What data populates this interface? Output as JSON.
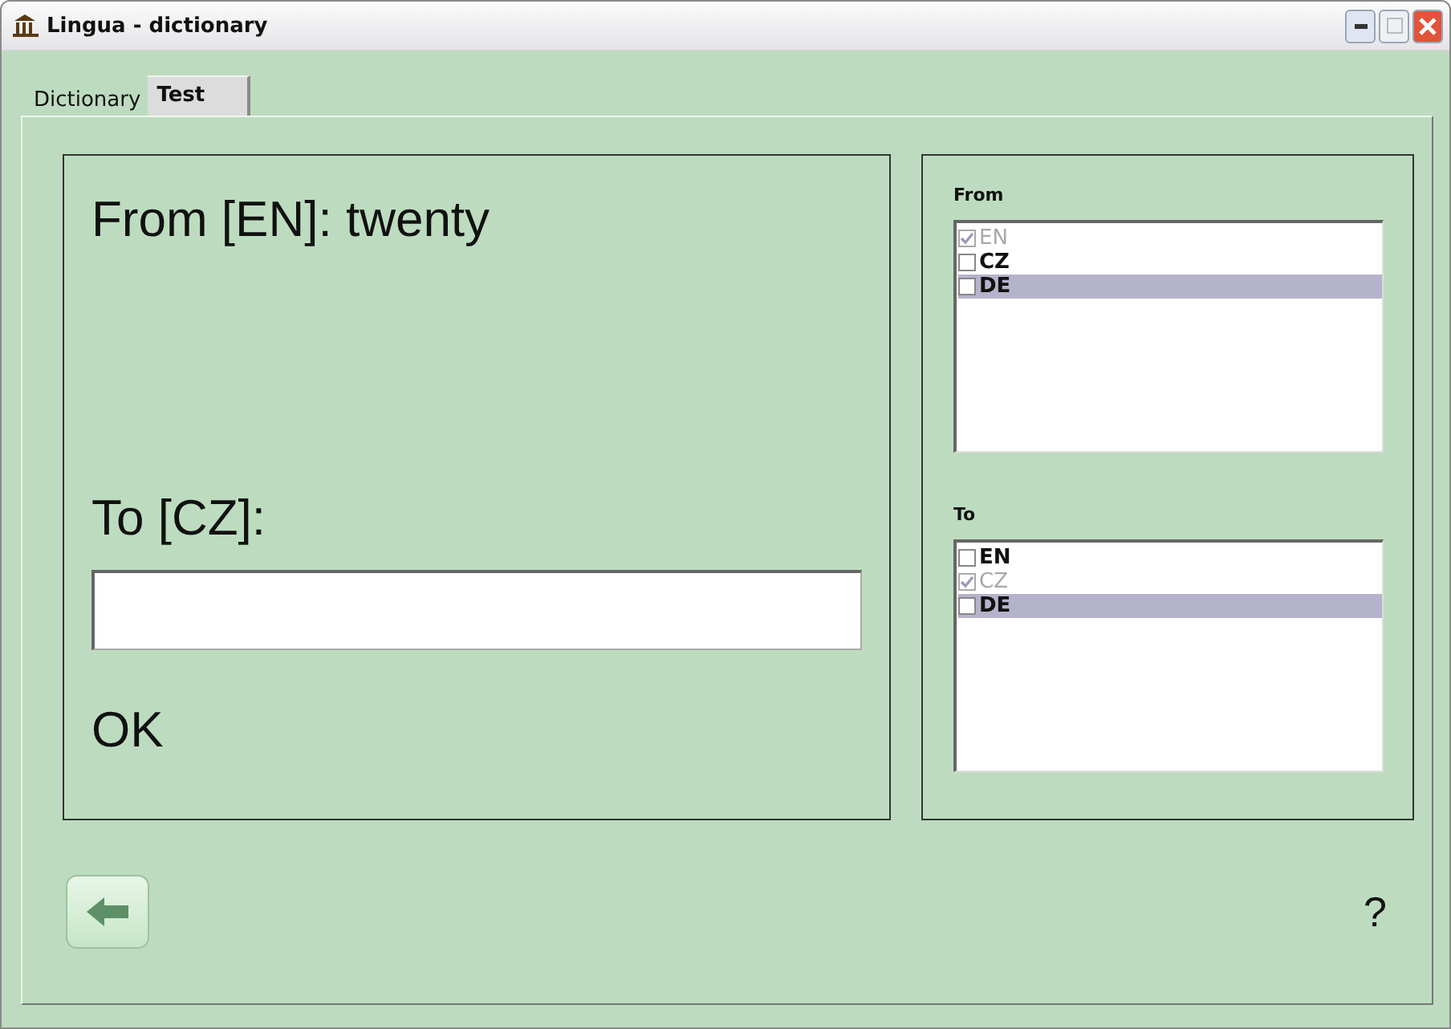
{
  "window": {
    "title": "Lingua - dictionary"
  },
  "tabs": [
    {
      "label": "Dictionary",
      "selected": false
    },
    {
      "label": "Test",
      "selected": true
    }
  ],
  "question": {
    "from_text": "From [EN]: twenty",
    "to_text": "To [CZ]:",
    "ok": "OK"
  },
  "from_list": {
    "label": "From",
    "items": [
      {
        "label": "EN",
        "checked": true,
        "disabled": true,
        "selected": false
      },
      {
        "label": "CZ",
        "checked": false,
        "disabled": false,
        "selected": false
      },
      {
        "label": "DE",
        "checked": false,
        "disabled": false,
        "selected": true
      }
    ]
  },
  "to_list": {
    "label": "To",
    "items": [
      {
        "label": "EN",
        "checked": false,
        "disabled": false,
        "selected": false
      },
      {
        "label": "CZ",
        "checked": true,
        "disabled": true,
        "selected": false
      },
      {
        "label": "DE",
        "checked": false,
        "disabled": false,
        "selected": true
      }
    ]
  },
  "help": "?"
}
